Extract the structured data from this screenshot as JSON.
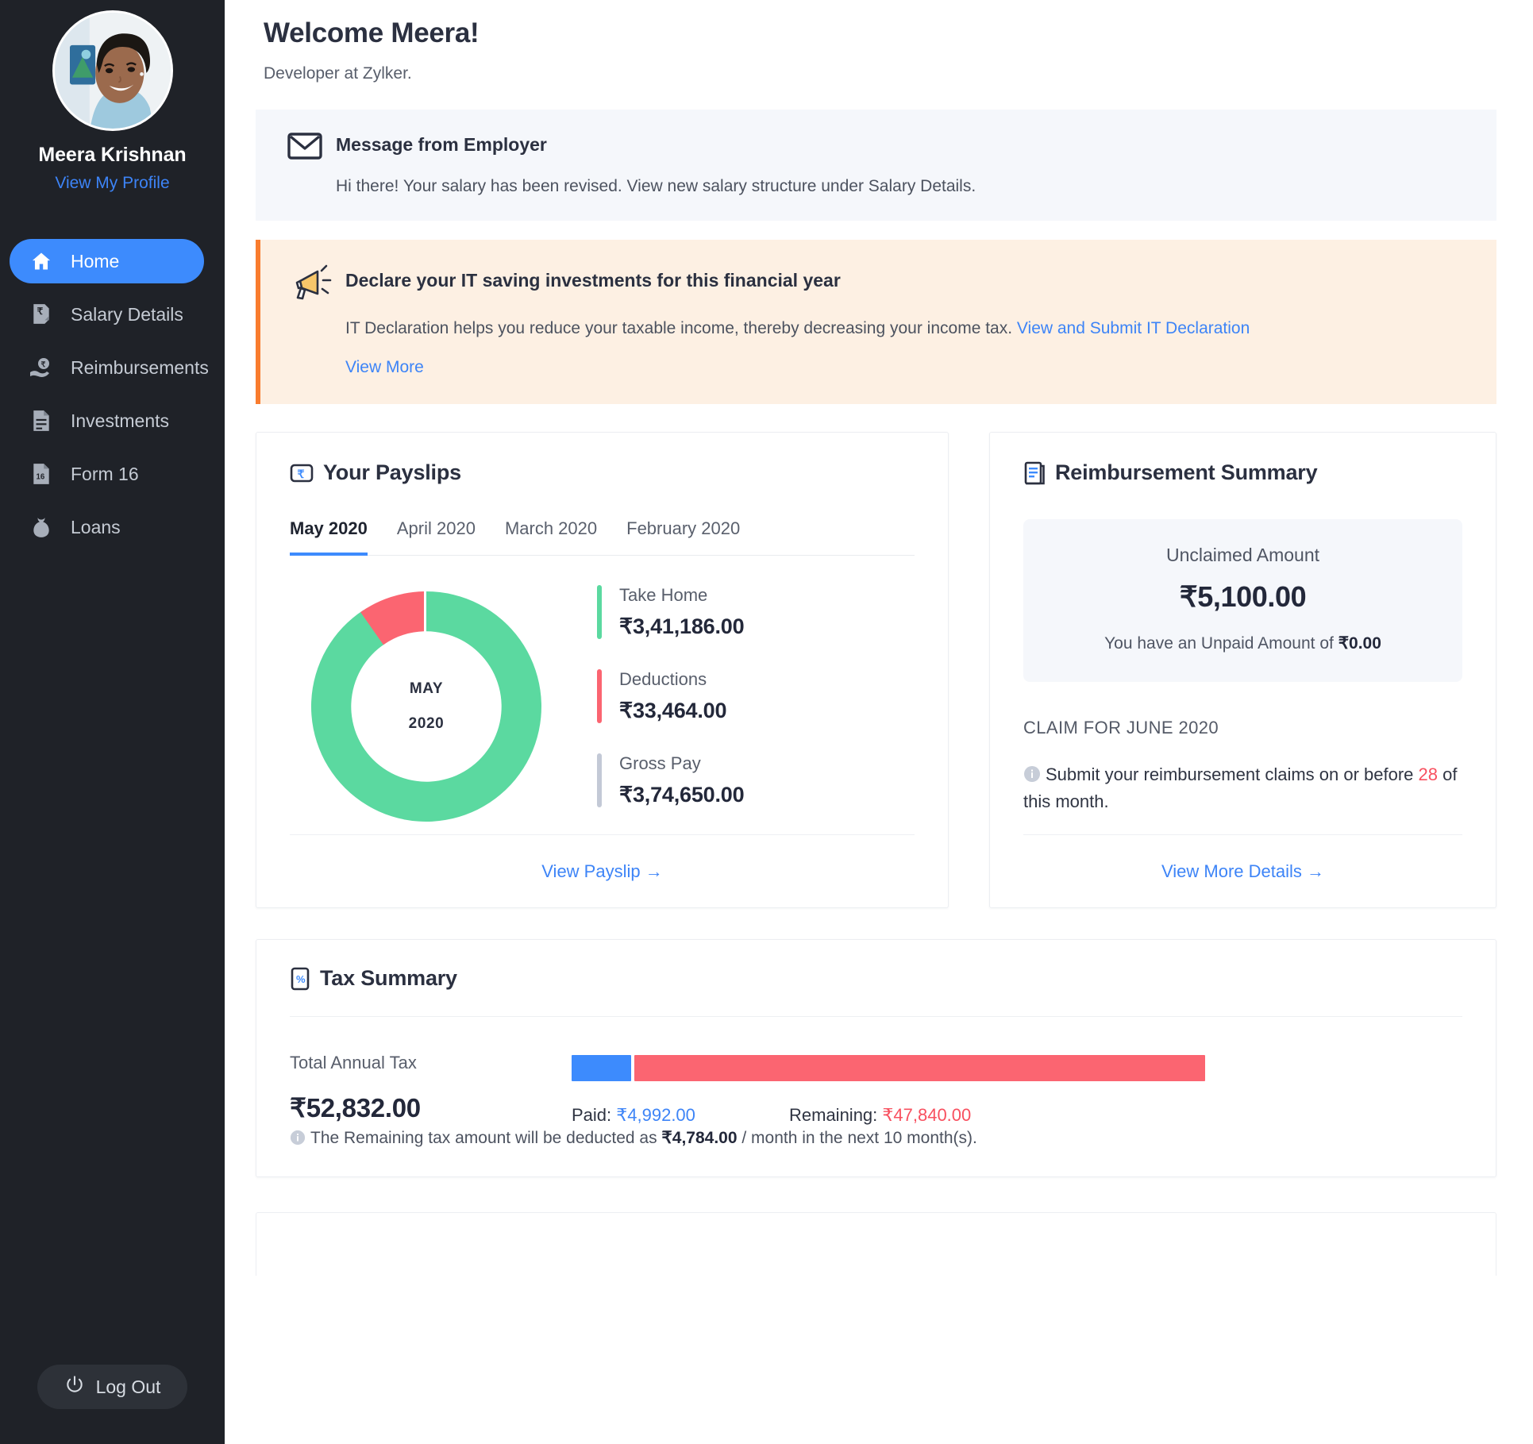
{
  "sidebar": {
    "profile": {
      "name": "Meera Krishnan",
      "profile_link": "View My Profile",
      "avatar_alt": "avatar"
    },
    "items": [
      {
        "label": "Home",
        "icon": "home-icon",
        "active": true
      },
      {
        "label": "Salary Details",
        "icon": "rupee-document-icon",
        "active": false
      },
      {
        "label": "Reimbursements",
        "icon": "hand-rupee-icon",
        "active": false
      },
      {
        "label": "Investments",
        "icon": "document-lines-icon",
        "active": false
      },
      {
        "label": "Form 16",
        "icon": "form-16-icon",
        "active": false
      },
      {
        "label": "Loans",
        "icon": "money-bag-icon",
        "active": false
      }
    ],
    "logout_label": "Log Out",
    "logout_icon": "power-icon"
  },
  "header": {
    "title": "Welcome Meera!",
    "subtitle": "Developer at Zylker."
  },
  "employer_message": {
    "icon": "envelope-icon",
    "title": "Message from Employer",
    "body": "Hi there! Your salary has been revised. View new salary structure under Salary Details."
  },
  "it_declaration": {
    "icon": "megaphone-icon",
    "title": "Declare your IT saving investments for this financial year",
    "body": "IT Declaration helps you reduce your taxable income, thereby decreasing your income tax.",
    "submit_link": "View and Submit IT Declaration",
    "view_more": "View More",
    "accent_color": "#f97c2e"
  },
  "payslips": {
    "icon": "payslip-rupee-icon",
    "title": "Your Payslips",
    "tabs": [
      {
        "label": "May 2020",
        "active": true
      },
      {
        "label": "April 2020",
        "active": false
      },
      {
        "label": "March 2020",
        "active": false
      },
      {
        "label": "February 2020",
        "active": false
      }
    ],
    "donut_center_month": "MAY",
    "donut_center_year": "2020",
    "legend": [
      {
        "label": "Take Home",
        "value": "₹3,41,186.00",
        "color": "#5bd9a0"
      },
      {
        "label": "Deductions",
        "value": "₹33,464.00",
        "color": "#fb6571"
      },
      {
        "label": "Gross Pay",
        "value": "₹3,74,650.00",
        "color": "#c3c9d6"
      }
    ],
    "footer_link": "View Payslip →"
  },
  "reimbursement": {
    "icon": "reimbursement-icon",
    "title": "Reimbursement Summary",
    "unclaimed_label": "Unclaimed Amount",
    "unclaimed_amount": "₹5,100.00",
    "unpaid_prefix": "You have an Unpaid Amount of ",
    "unpaid_amount": "₹0.00",
    "claim_heading": "CLAIM FOR JUNE 2020",
    "claim_note_prefix": "Submit your reimbursement claims on or before ",
    "claim_deadline": "28",
    "claim_note_suffix": " of this month.",
    "footer_link": "View More Details →"
  },
  "tax_summary": {
    "icon": "tax-calculator-icon",
    "title": "Tax Summary",
    "total_label": "Total Annual Tax",
    "total_value": "₹52,832.00",
    "paid_label": "Paid: ",
    "paid_value": "₹4,992.00",
    "remaining_label": "Remaining: ",
    "remaining_value": "₹47,840.00",
    "footnote_prefix": "The Remaining tax amount will be deducted as ",
    "footnote_amount": "₹4,784.00",
    "footnote_suffix": " / month in the next 10 month(s)."
  },
  "chart_data": [
    {
      "type": "pie",
      "title": "Your Payslips — May 2020",
      "categories": [
        "Take Home",
        "Deductions"
      ],
      "values": [
        341186,
        33464
      ],
      "value_labels": [
        "₹3,41,186.00",
        "₹33,464.00"
      ],
      "colors": [
        "#5bd9a0",
        "#fb6571"
      ],
      "total": 374650,
      "total_label": "Gross Pay",
      "total_value_label": "₹3,74,650.00",
      "center_text": [
        "MAY",
        "2020"
      ],
      "percentages": [
        91.07,
        8.93
      ],
      "legend_position": "right",
      "donut": true
    },
    {
      "type": "bar",
      "title": "Tax Summary",
      "orientation": "horizontal",
      "stacked": true,
      "categories": [
        "Total Annual Tax"
      ],
      "series": [
        {
          "name": "Paid",
          "values": [
            4992
          ],
          "color": "#3d8bfd"
        },
        {
          "name": "Remaining",
          "values": [
            47840
          ],
          "color": "#fb6571"
        }
      ],
      "total": 52832,
      "total_label": "₹52,832.00",
      "percentages": [
        9.45,
        90.55
      ],
      "grid": false,
      "legend_position": "bottom"
    }
  ],
  "colors": {
    "accent_blue": "#3d8bfd",
    "link_blue": "#3d84f7",
    "green": "#5bd9a0",
    "red": "#fb6571",
    "red_text": "#f8505f",
    "orange": "#f97c2e",
    "sidebar_bg": "#1f2228"
  }
}
